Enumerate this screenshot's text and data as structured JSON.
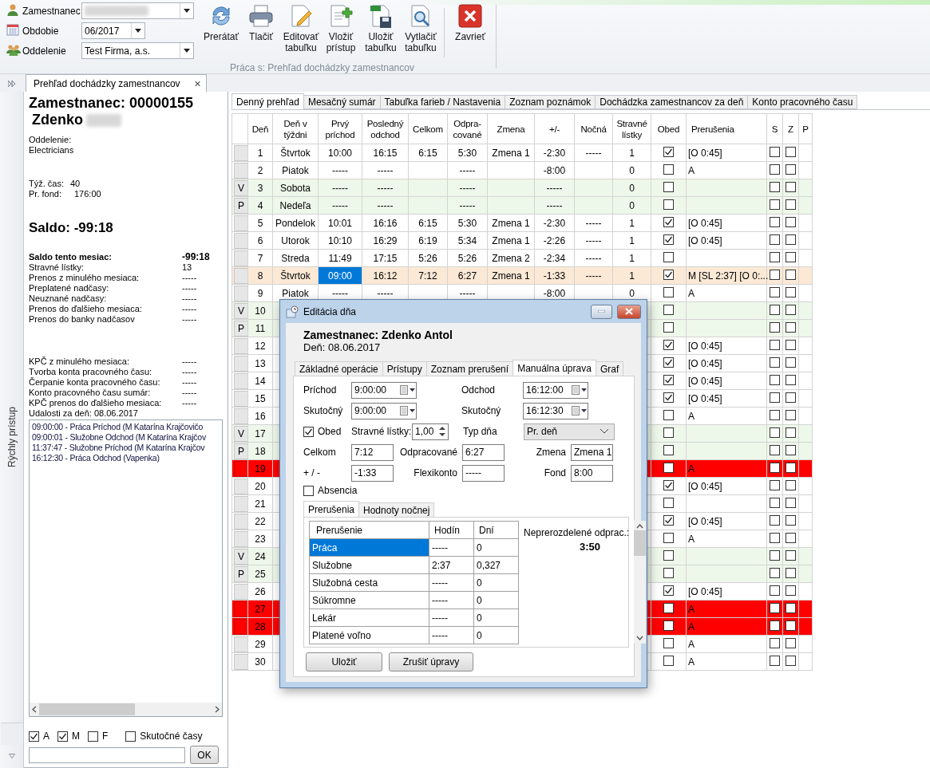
{
  "toolbar": {
    "filters": [
      {
        "kind": "employee",
        "label": "Zamestnanec",
        "redacted": true
      },
      {
        "kind": "period",
        "label": "Obdobie",
        "value": "06/2017"
      },
      {
        "kind": "department",
        "label": "Oddelenie",
        "value": "Test Firma, a.s."
      }
    ],
    "buttons": [
      {
        "kind": "refresh",
        "label": "Prerátať"
      },
      {
        "kind": "print",
        "label": "Tlačiť"
      },
      {
        "kind": "edit",
        "label": "Editovať\ntabuľku"
      },
      {
        "kind": "add",
        "label": "Vložiť\nprístup"
      },
      {
        "kind": "save",
        "label": "Uložiť\ntabuľku"
      },
      {
        "kind": "preview",
        "label": "Vytlačiť\ntabuľku"
      },
      {
        "kind": "close",
        "label": "Zavrieť"
      }
    ],
    "group_caption": "Práca s: Prehľad dochádzky zamestnancov"
  },
  "quick_access": {
    "label": "Rýchly prístup"
  },
  "document_tab": {
    "title": "Prehľad dochádzky zamestnancov",
    "close": "×"
  },
  "employee_panel": {
    "heading": "Zamestnanec: 00000155",
    "first_name": "Zdenko",
    "surname_redacted": true,
    "department_label": "Oddelenie:",
    "department": "Electricians",
    "stats": [
      {
        "label": "Týž. čas:",
        "value": "40"
      },
      {
        "label": "Pr. fond:",
        "value": "176:00"
      }
    ],
    "saldo": "Saldo: -99:18",
    "summary": [
      {
        "label": "Saldo tento mesiac:",
        "value": "-99:18",
        "bold": true
      },
      {
        "label": "Stravné lístky:",
        "value": "13",
        "bold": false
      },
      {
        "label": "Prenos z minulého mesiaca:",
        "value": "-----",
        "bold": false
      },
      {
        "label": "Preplatené nadčasy:",
        "value": "-----",
        "bold": false
      },
      {
        "label": "Neuznané nadčasy:",
        "value": "-----",
        "bold": false
      },
      {
        "label": "Prenos do ďalšieho mesiaca:",
        "value": "-----",
        "bold": false
      },
      {
        "label": "Prenos do banky nadčasov",
        "value": "-----",
        "bold": false
      }
    ],
    "account": [
      {
        "label": "KPČ z minulého mesiaca:",
        "value": "-----"
      },
      {
        "label": "Tvorba konta pracovného času:",
        "value": "-----"
      },
      {
        "label": "Čerpanie konta pracovného času:",
        "value": "-----"
      },
      {
        "label": "Konto pracovného času sumár:",
        "value": "-----"
      },
      {
        "label": "KPČ prenos do ďalšieho mesiaca:",
        "value": "-----"
      }
    ],
    "events_label": "Udalosti za deň: 08.06.2017",
    "events": [
      "09:00:00 - Práca Príchod (M Katarína Krajčovičo",
      "09:00:01 - Služobne Odchod (M Katarína Krajčov",
      "11:37:47 - Služobne Príchod (M Katarína Krajčov",
      "16:12:30 - Práca Odchod (Vapenka)"
    ],
    "filters": [
      {
        "label": "A",
        "checked": true
      },
      {
        "label": "M",
        "checked": true
      },
      {
        "label": "F",
        "checked": false
      },
      {
        "label": "Skutočné časy",
        "checked": false
      }
    ],
    "ok_button": "OK"
  },
  "tabs": [
    {
      "label": "Denný prehľad",
      "selected": true
    },
    {
      "label": "Mesačný sumár",
      "selected": false
    },
    {
      "label": "Tabuľka farieb / Nastavenia",
      "selected": false
    },
    {
      "label": "Zoznam poznámok",
      "selected": false
    },
    {
      "label": "Dochádzka zamestnancov za deň",
      "selected": false
    },
    {
      "label": "Konto pracovného času",
      "selected": false
    }
  ],
  "table": {
    "columns": [
      "Deň",
      "Deň v týždni",
      "Prvý príchod",
      "Posledný odchod",
      "Celkom",
      "Odpra-cované",
      "Zmena",
      "+/-",
      "Nočná",
      "Stravné lístky",
      "Obed",
      "Prerušenia",
      "S",
      "Z",
      "P"
    ],
    "rows": [
      {
        "kind": "workday",
        "day": "1",
        "first_in_selected": false,
        "weekday": "Štvrtok",
        "first_in": "10:00",
        "last_out": "16:15",
        "total": "6:15",
        "worked": "5:30",
        "shift": "Zmena 1",
        "diff": "-2:30",
        "night": "-----",
        "meals": "1",
        "lunch": true,
        "breaks": "[O 0:45]",
        "s": false,
        "z": false
      },
      {
        "kind": "workday",
        "day": "2",
        "first_in_selected": false,
        "weekday": "Piatok",
        "first_in": "-----",
        "last_out": "-----",
        "worked": "-----",
        "diff": "-8:00",
        "meals": "0",
        "lunch": false,
        "breaks": "A",
        "s": false,
        "z": false
      },
      {
        "kind": "weekend",
        "mark": "V",
        "day": "3",
        "first_in_selected": false,
        "weekday": "Sobota",
        "first_in": "-----",
        "last_out": "-----",
        "worked": "-----",
        "diff": "-----",
        "meals": "0",
        "lunch": false,
        "s": false,
        "z": false
      },
      {
        "kind": "weekend",
        "mark": "P",
        "day": "4",
        "first_in_selected": false,
        "weekday": "Nedeľa",
        "first_in": "-----",
        "last_out": "-----",
        "worked": "-----",
        "diff": "-----",
        "meals": "0",
        "lunch": false,
        "s": false,
        "z": false
      },
      {
        "kind": "workday",
        "day": "5",
        "first_in_selected": false,
        "weekday": "Pondelok",
        "first_in": "10:01",
        "last_out": "16:16",
        "total": "6:15",
        "worked": "5:30",
        "shift": "Zmena 1",
        "diff": "-2:30",
        "night": "-----",
        "meals": "1",
        "lunch": true,
        "breaks": "[O 0:45]",
        "s": false,
        "z": false
      },
      {
        "kind": "workday",
        "day": "6",
        "first_in_selected": false,
        "weekday": "Utorok",
        "first_in": "10:10",
        "last_out": "16:29",
        "total": "6:19",
        "worked": "5:34",
        "shift": "Zmena 1",
        "diff": "-2:26",
        "night": "-----",
        "meals": "1",
        "lunch": true,
        "breaks": "[O 0:45]",
        "s": false,
        "z": false
      },
      {
        "kind": "workday",
        "day": "7",
        "first_in_selected": false,
        "weekday": "Streda",
        "first_in": "11:49",
        "last_out": "17:15",
        "total": "5:26",
        "worked": "5:26",
        "shift": "Zmena 2",
        "diff": "-2:34",
        "night": "-----",
        "meals": "1",
        "lunch": false,
        "s": false,
        "z": false
      },
      {
        "kind": "current",
        "day": "8",
        "weekday": "Štvrtok",
        "first_in": "09:00",
        "first_in_selected": true,
        "last_out": "16:12",
        "total": "7:12",
        "worked": "6:27",
        "shift": "Zmena 1",
        "diff": "-1:33",
        "night": "-----",
        "meals": "1",
        "lunch": true,
        "breaks": "M [SL 2:37] [O 0:...",
        "s": false,
        "z": false
      },
      {
        "kind": "workday",
        "day": "9",
        "first_in_selected": false,
        "weekday": "Piatok",
        "first_in": "-----",
        "last_out": "-----",
        "worked": "-----",
        "diff": "-8:00",
        "meals": "0",
        "lunch": false,
        "breaks": "A",
        "s": false,
        "z": false
      },
      {
        "kind": "weekend",
        "mark": "V",
        "day": "10",
        "lunch": false,
        "s": false,
        "z": false
      },
      {
        "kind": "weekend",
        "mark": "P",
        "day": "11",
        "lunch": false,
        "s": false,
        "z": false
      },
      {
        "kind": "workday",
        "day": "12",
        "lunch": true,
        "breaks": "[O 0:45]",
        "s": false,
        "z": false
      },
      {
        "kind": "workday",
        "day": "13",
        "lunch": true,
        "breaks": "[O 0:45]",
        "s": false,
        "z": false
      },
      {
        "kind": "workday",
        "day": "14",
        "lunch": true,
        "breaks": "[O 0:45]",
        "s": false,
        "z": false
      },
      {
        "kind": "workday",
        "day": "15",
        "lunch": true,
        "breaks": "[O 0:45]",
        "s": false,
        "z": false
      },
      {
        "kind": "workday",
        "day": "16",
        "lunch": false,
        "breaks": "A",
        "s": false,
        "z": false
      },
      {
        "kind": "weekend",
        "mark": "V",
        "day": "17",
        "lunch": false,
        "s": false,
        "z": false
      },
      {
        "kind": "weekend",
        "mark": "P",
        "day": "18",
        "lunch": false,
        "s": false,
        "z": false
      },
      {
        "kind": "absence",
        "day": "19",
        "lunch": false,
        "breaks": "A",
        "s": false,
        "z": false
      },
      {
        "kind": "workday",
        "day": "20",
        "lunch": true,
        "breaks": "[O 0:45]",
        "s": false,
        "z": false
      },
      {
        "kind": "workday",
        "day": "21",
        "lunch": false,
        "s": false,
        "z": false
      },
      {
        "kind": "workday",
        "day": "22",
        "lunch": true,
        "breaks": "[O 0:45]",
        "s": false,
        "z": false
      },
      {
        "kind": "workday",
        "day": "23",
        "lunch": false,
        "breaks": "A",
        "s": false,
        "z": false
      },
      {
        "kind": "weekend",
        "mark": "V",
        "day": "24",
        "lunch": false,
        "s": false,
        "z": false
      },
      {
        "kind": "weekend",
        "mark": "P",
        "day": "25",
        "lunch": false,
        "s": false,
        "z": false
      },
      {
        "kind": "workday",
        "day": "26",
        "lunch": true,
        "breaks": "[O 0:45]",
        "s": false,
        "z": false
      },
      {
        "kind": "absence",
        "day": "27",
        "lunch": false,
        "breaks": "A",
        "s": false,
        "z": false
      },
      {
        "kind": "absence",
        "day": "28",
        "lunch": false,
        "breaks": "A",
        "s": false,
        "z": false
      },
      {
        "kind": "workday",
        "day": "29",
        "lunch": false,
        "breaks": "A",
        "s": false,
        "z": false
      },
      {
        "kind": "workday",
        "day": "30",
        "lunch": false,
        "breaks": "A",
        "s": false,
        "z": false
      }
    ]
  },
  "dialog": {
    "title": "Editácia dňa",
    "employee": "Zamestnanec: Zdenko Antol",
    "day": "Deň: 08.06.2017",
    "tabs": [
      {
        "label": "Základné operácie",
        "selected": false
      },
      {
        "label": "Prístupy",
        "selected": false
      },
      {
        "label": "Zoznam prerušení",
        "selected": false
      },
      {
        "label": "Manuálna úprava",
        "selected": true
      },
      {
        "label": "Graf",
        "selected": false
      }
    ],
    "arrival": {
      "label": "Príchod",
      "value": "9:00:00"
    },
    "departure": {
      "label": "Odchod",
      "value": "16:12:00"
    },
    "arrival_actual": {
      "label": "Skutočný",
      "value": "9:00:00"
    },
    "departure_actual": {
      "label": "Skutočný",
      "value": "16:12:30"
    },
    "lunch": {
      "label": "Obed",
      "checked": true
    },
    "meal_tickets": {
      "label": "Stravné lístky:",
      "value": "1,00"
    },
    "day_type": {
      "label": "Typ dňa",
      "value": "Pr. deň"
    },
    "total": {
      "label": "Celkom",
      "value": "7:12"
    },
    "worked": {
      "label": "Odpracované",
      "value": "6:27"
    },
    "shift": {
      "label": "Zmena",
      "value": "Zmena 1"
    },
    "diff": {
      "label": "+ / -",
      "value": "-1:33"
    },
    "flexi": {
      "label": "Flexikonto",
      "value": "-----"
    },
    "fund": {
      "label": "Fond",
      "value": "8:00"
    },
    "absence": {
      "label": "Absencia",
      "checked": false
    },
    "subtabs": [
      {
        "label": "Prerušenia",
        "selected": true
      },
      {
        "label": "Hodnoty nočnej",
        "selected": false
      }
    ],
    "breaks": {
      "columns": [
        "Prerušenie",
        "Hodín",
        "Dní"
      ],
      "rows": [
        {
          "name": "Práca",
          "hours": "-----",
          "days": "0",
          "selected": true
        },
        {
          "name": "Služobne",
          "hours": "2:37",
          "days": "0,327",
          "selected": false
        },
        {
          "name": "Služobná cesta",
          "hours": "-----",
          "days": "0",
          "selected": false
        },
        {
          "name": "Súkromne",
          "hours": "-----",
          "days": "0",
          "selected": false
        },
        {
          "name": "Lekár",
          "hours": "-----",
          "days": "0",
          "selected": false
        },
        {
          "name": "Platené voľno",
          "hours": "-----",
          "days": "0",
          "selected": false
        }
      ]
    },
    "unallocated_label": "Neprerozdelené odprac.:",
    "unallocated_value": "3:50",
    "buttons": [
      "Uložiť",
      "Zrušiť úpravy"
    ]
  }
}
